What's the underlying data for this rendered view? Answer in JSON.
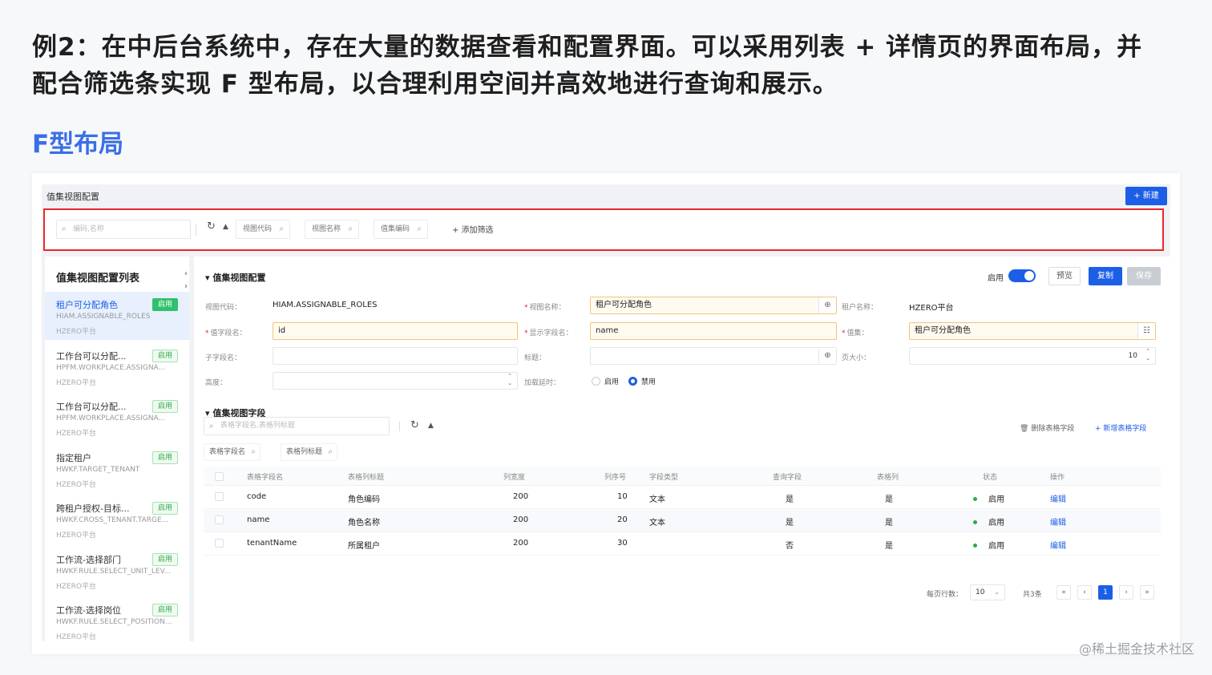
{
  "intro": {
    "line1": "例2：在中后台系统中，存在大量的数据查看和配置界面。可以采用列表 + 详情页的界面布局，并",
    "line2": "配合筛选条实现 F 型布局，以合理利用空间并高效地进行查询和展示。"
  },
  "section_title": "F型布局",
  "app": {
    "title": "值集视图配置",
    "new_button": "+ 新建",
    "filter": {
      "search_placeholder": "编码,名称",
      "chips": [
        "视图代码",
        "视图名称",
        "值集编码"
      ],
      "add_filter": "+ 添加筛选"
    },
    "sidebar": {
      "title": "值集视图配置列表",
      "nav_prev": "‹",
      "nav_next": "›",
      "items": [
        {
          "name": "租户可分配角色",
          "code": "HIAM.ASSIGNABLE_ROLES",
          "tenant": "HZERO平台",
          "badge": "启用"
        },
        {
          "name": "工作台可以分配...",
          "code": "HPFM.WORKPLACE.ASSIGNA...",
          "tenant": "HZERO平台",
          "badge": "启用"
        },
        {
          "name": "工作台可以分配...",
          "code": "HPFM.WORKPLACE.ASSIGNA...",
          "tenant": "HZERO平台",
          "badge": "启用"
        },
        {
          "name": "指定租户",
          "code": "HWKF.TARGET_TENANT",
          "tenant": "HZERO平台",
          "badge": "启用"
        },
        {
          "name": "跨租户授权-目标...",
          "code": "HWKF.CROSS_TENANT.TARGE...",
          "tenant": "HZERO平台",
          "badge": "启用"
        },
        {
          "name": "工作流-选择部门",
          "code": "HWKF.RULE.SELECT_UNIT_LEV...",
          "tenant": "HZERO平台",
          "badge": "启用"
        },
        {
          "name": "工作流-选择岗位",
          "code": "HWKF.RULE.SELECT_POSITION...",
          "tenant": "HZERO平台",
          "badge": "启用"
        }
      ]
    },
    "detail": {
      "section_title": "值集视图配置",
      "toggle_label": "启用",
      "preview": "预览",
      "copy": "复制",
      "save": "保存",
      "labels": {
        "view_code": "视图代码：",
        "view_name": "视图名称：",
        "tenant_name": "租户名称：",
        "value_field": "值字段名：",
        "display_field": "显示字段名：",
        "value_set": "值集：",
        "child_field": "子字段名：",
        "title": "标题：",
        "page_size": "页大小：",
        "height": "高度：",
        "lazy_load": "加载延时："
      },
      "values": {
        "view_code": "HIAM.ASSIGNABLE_ROLES",
        "view_name": "租户可分配角色",
        "tenant_name": "HZERO平台",
        "value_field": "id",
        "display_field": "name",
        "value_set": "租户可分配角色",
        "page_size": "10"
      },
      "radio_on": "启用",
      "radio_off": "禁用"
    },
    "fields": {
      "section_title": "值集视图字段",
      "search_placeholder": "表格字段名,表格列标题",
      "delete": "删除表格字段",
      "add": "+ 新增表格字段",
      "chips": [
        "表格字段名",
        "表格列标题"
      ],
      "headers": [
        "表格字段名",
        "表格列标题",
        "列宽度",
        "列序号",
        "字段类型",
        "查询字段",
        "表格列",
        "状态",
        "操作"
      ],
      "rows": [
        {
          "field": "code",
          "title": "角色编码",
          "width": "200",
          "order": "10",
          "type": "文本",
          "query": "是",
          "column": "是",
          "status": "启用",
          "action": "编辑"
        },
        {
          "field": "name",
          "title": "角色名称",
          "width": "200",
          "order": "20",
          "type": "文本",
          "query": "是",
          "column": "是",
          "status": "启用",
          "action": "编辑"
        },
        {
          "field": "tenantName",
          "title": "所属租户",
          "width": "200",
          "order": "30",
          "type": "",
          "query": "否",
          "column": "是",
          "status": "启用",
          "action": "编辑"
        }
      ],
      "pager": {
        "per_page_label": "每页行数：",
        "per_page": "10",
        "total": "共3条",
        "current": "1"
      }
    }
  },
  "credit": "@稀土掘金技术社区",
  "colors": {
    "primary": "#1c5ee6",
    "highlight_box": "#e8282b",
    "enabled_green": "#2cab46",
    "heading_blue": "#3a6fe6"
  }
}
